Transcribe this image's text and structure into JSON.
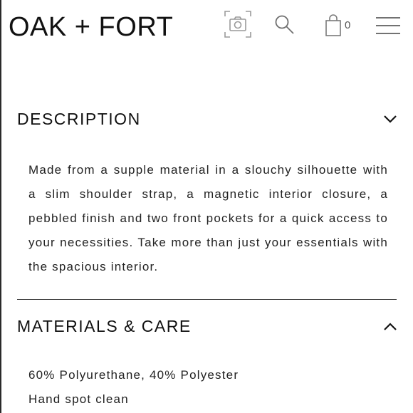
{
  "header": {
    "logo": "OAK + FORT",
    "cart_count": "0",
    "icons": {
      "camera": "camera-scan-icon",
      "search": "search-icon",
      "cart": "shopping-bag-icon",
      "menu": "hamburger-menu-icon"
    }
  },
  "description": {
    "title": "DESCRIPTION",
    "expanded": false,
    "chevron": "chevron-down-icon",
    "text": "Made from a supple material in a slouchy silhouette with a slim shoulder strap, a magnetic interior closure, a pebbled finish and two front pockets for a quick access to your necessities. Take more than just your essentials with the spacious interior."
  },
  "materials": {
    "title": "MATERIALS & CARE",
    "expanded": true,
    "chevron": "chevron-up-icon",
    "lines": [
      "60% Polyurethane, 40% Polyester",
      "Hand spot clean"
    ]
  },
  "colors": {
    "text": "#111111",
    "icon": "#8c8c8c",
    "divider": "#333333",
    "background": "#ffffff"
  }
}
